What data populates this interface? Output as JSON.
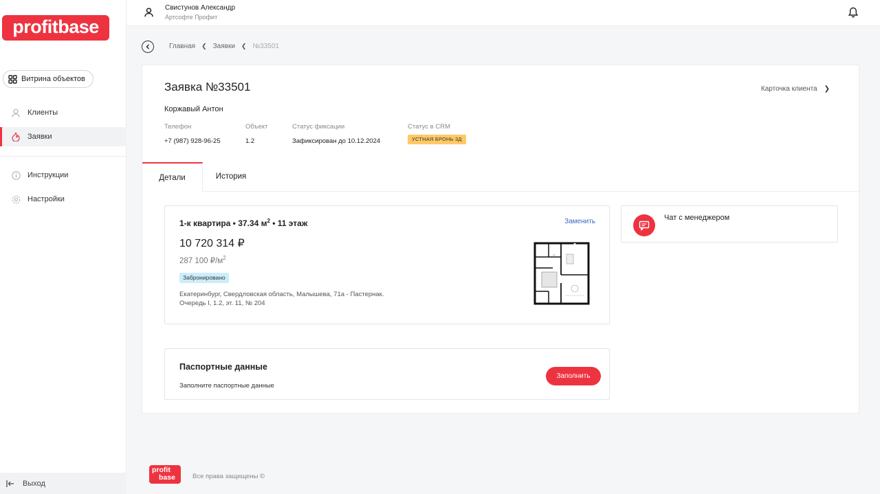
{
  "brand": {
    "logo_text": "profitbase",
    "footer_logo_line1": "profit",
    "footer_logo_line2": "base",
    "accent": "#ee3340"
  },
  "sidebar": {
    "showcase_label": "Витрина объектов",
    "items": [
      {
        "label": "Клиенты",
        "icon": "user-icon",
        "active": false
      },
      {
        "label": "Заявки",
        "icon": "flame-icon",
        "active": true
      },
      {
        "label": "Инструкции",
        "icon": "info-icon",
        "active": false
      },
      {
        "label": "Настройки",
        "icon": "gear-icon",
        "active": false
      }
    ],
    "exit_label": "Выход"
  },
  "topbar": {
    "user_name": "Свистунов Александр",
    "company": "Артсофте Профит"
  },
  "breadcrumb": {
    "home": "Главная",
    "section": "Заявки",
    "current": "№33501"
  },
  "order": {
    "title": "Заявка №33501",
    "client_card_link": "Карточка клиента",
    "client_name": "Коржавый Антон",
    "phone_label": "Телефон",
    "phone": "+7 (987) 928-96-25",
    "object_label": "Объект",
    "object": "1.2",
    "fix_status_label": "Статус фиксации",
    "fix_status": "Зафиксирован до 10.12.2024",
    "crm_status_label": "Статус в CRM",
    "crm_status": "УСТНАЯ БРОНЬ 3Д",
    "crm_color": "#ffc965"
  },
  "tabs": [
    {
      "label": "Детали",
      "active": true
    },
    {
      "label": "История",
      "active": false
    }
  ],
  "apartment": {
    "title": "1-к квартира • 37.34 м",
    "title_sup": "2",
    "title_tail": " • 11 этаж",
    "replace_label": "Заменить",
    "price": "10 720 314  ₽",
    "price_per_m": "287 100  ₽/м",
    "price_per_m_sup": "2",
    "status": "Забронировано",
    "status_color": "#cbeefa",
    "address": "Екатеринбург, Свердловская область, Малышева, 71а - Пастернак. Очередь I, 1.2, эт. 11, № 204"
  },
  "chat": {
    "label": "Чат с менеджером"
  },
  "passport": {
    "title": "Паспортные данные",
    "subtitle": "Заполните паспортные данные",
    "button": "Заполнить"
  },
  "footer": {
    "copyright": "Все права защищены ©"
  }
}
